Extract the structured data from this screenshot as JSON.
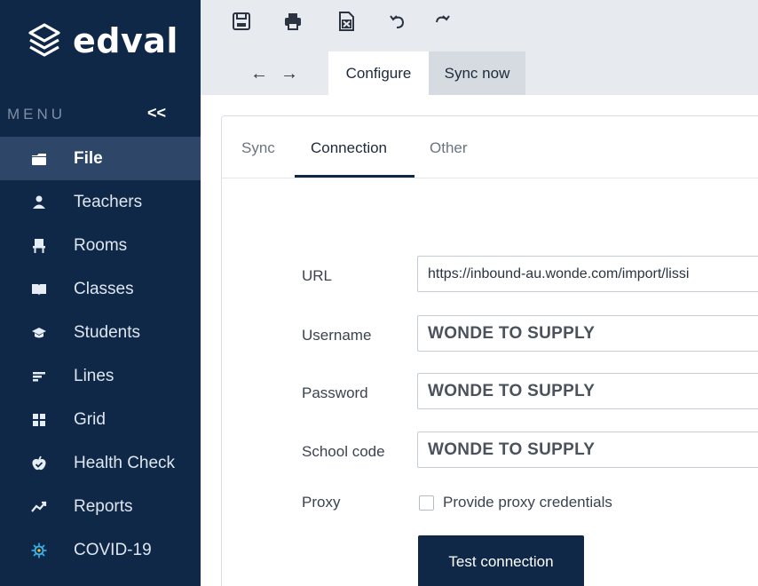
{
  "brand": {
    "name": "edval"
  },
  "menu": {
    "label": "MENU",
    "collapse_glyph": "<<"
  },
  "sidebar": {
    "items": [
      {
        "label": "File",
        "icon": "folder-icon",
        "active": true
      },
      {
        "label": "Teachers",
        "icon": "person-icon",
        "active": false
      },
      {
        "label": "Rooms",
        "icon": "chair-icon",
        "active": false
      },
      {
        "label": "Classes",
        "icon": "book-icon",
        "active": false
      },
      {
        "label": "Students",
        "icon": "graduation-cap-icon",
        "active": false
      },
      {
        "label": "Lines",
        "icon": "lines-icon",
        "active": false
      },
      {
        "label": "Grid",
        "icon": "grid-icon",
        "active": false
      },
      {
        "label": "Health Check",
        "icon": "apple-icon",
        "active": false
      },
      {
        "label": "Reports",
        "icon": "trend-icon",
        "active": false
      },
      {
        "label": "COVID-19",
        "icon": "virus-icon",
        "active": false
      }
    ]
  },
  "toolbar": {
    "icons": [
      "save-icon",
      "print-icon",
      "excel-icon",
      "undo-icon",
      "redo-icon"
    ],
    "back_glyph": "←",
    "forward_glyph": "→",
    "tabs": [
      {
        "label": "Configure",
        "active": true
      },
      {
        "label": "Sync now",
        "active": false
      }
    ]
  },
  "panel": {
    "subtabs": [
      {
        "label": "Sync",
        "active": false
      },
      {
        "label": "Connection",
        "active": true
      },
      {
        "label": "Other",
        "active": false
      }
    ],
    "fields": {
      "url": {
        "label": "URL",
        "value": "https://inbound-au.wonde.com/import/lissi"
      },
      "username": {
        "label": "Username",
        "value": "WONDE TO SUPPLY"
      },
      "password": {
        "label": "Password",
        "value": "WONDE TO SUPPLY"
      },
      "school_code": {
        "label": "School code",
        "value": "WONDE TO SUPPLY"
      },
      "proxy": {
        "label": "Proxy",
        "checkbox_label": "Provide proxy credentials",
        "checked": false
      }
    },
    "test_button": "Test connection"
  },
  "colors": {
    "sidebar_bg": "#0f2847",
    "sidebar_active": "#2e4769",
    "toolbar_bg": "#e7eaee",
    "accent": "#0f2847",
    "covid_icon": "#36b6e8"
  }
}
